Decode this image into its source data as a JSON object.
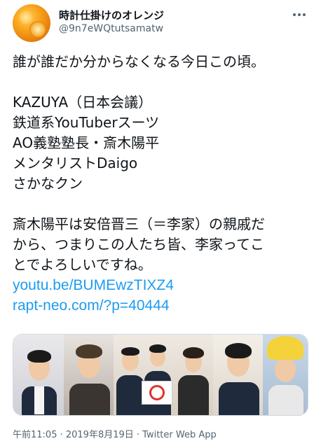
{
  "tweet": {
    "author": {
      "display_name": "時計仕掛けのオレンジ",
      "handle": "@9n7eWQtutsamatw"
    },
    "more_icon": "more-horizontal-icon",
    "text": {
      "intro": "誰が誰だか分からなくなる今日この頃。",
      "list": [
        "KAZUYA（日本会議）",
        "鉄道系YouTuberスーツ",
        "AO義塾塾長・斎木陽平",
        "メンタリストDaigo",
        "さかなクン"
      ],
      "conclusion_lines": [
        "斎木陽平は安倍晋三（＝李家）の親戚だ",
        "から、つまりこの人たち皆、李家ってこ",
        "とでよろしいですね。"
      ],
      "links": [
        "youtu.be/BUMEwzTIXZ4",
        "rapt-neo.com/?p=40444"
      ]
    },
    "media": {
      "photo_count": 5
    },
    "timestamp": "午前11:05 · 2019年8月19日 · Twitter Web App",
    "colors": {
      "link": "#1d9bf0",
      "secondary_text": "#536471",
      "primary_text": "#0f1419"
    }
  }
}
